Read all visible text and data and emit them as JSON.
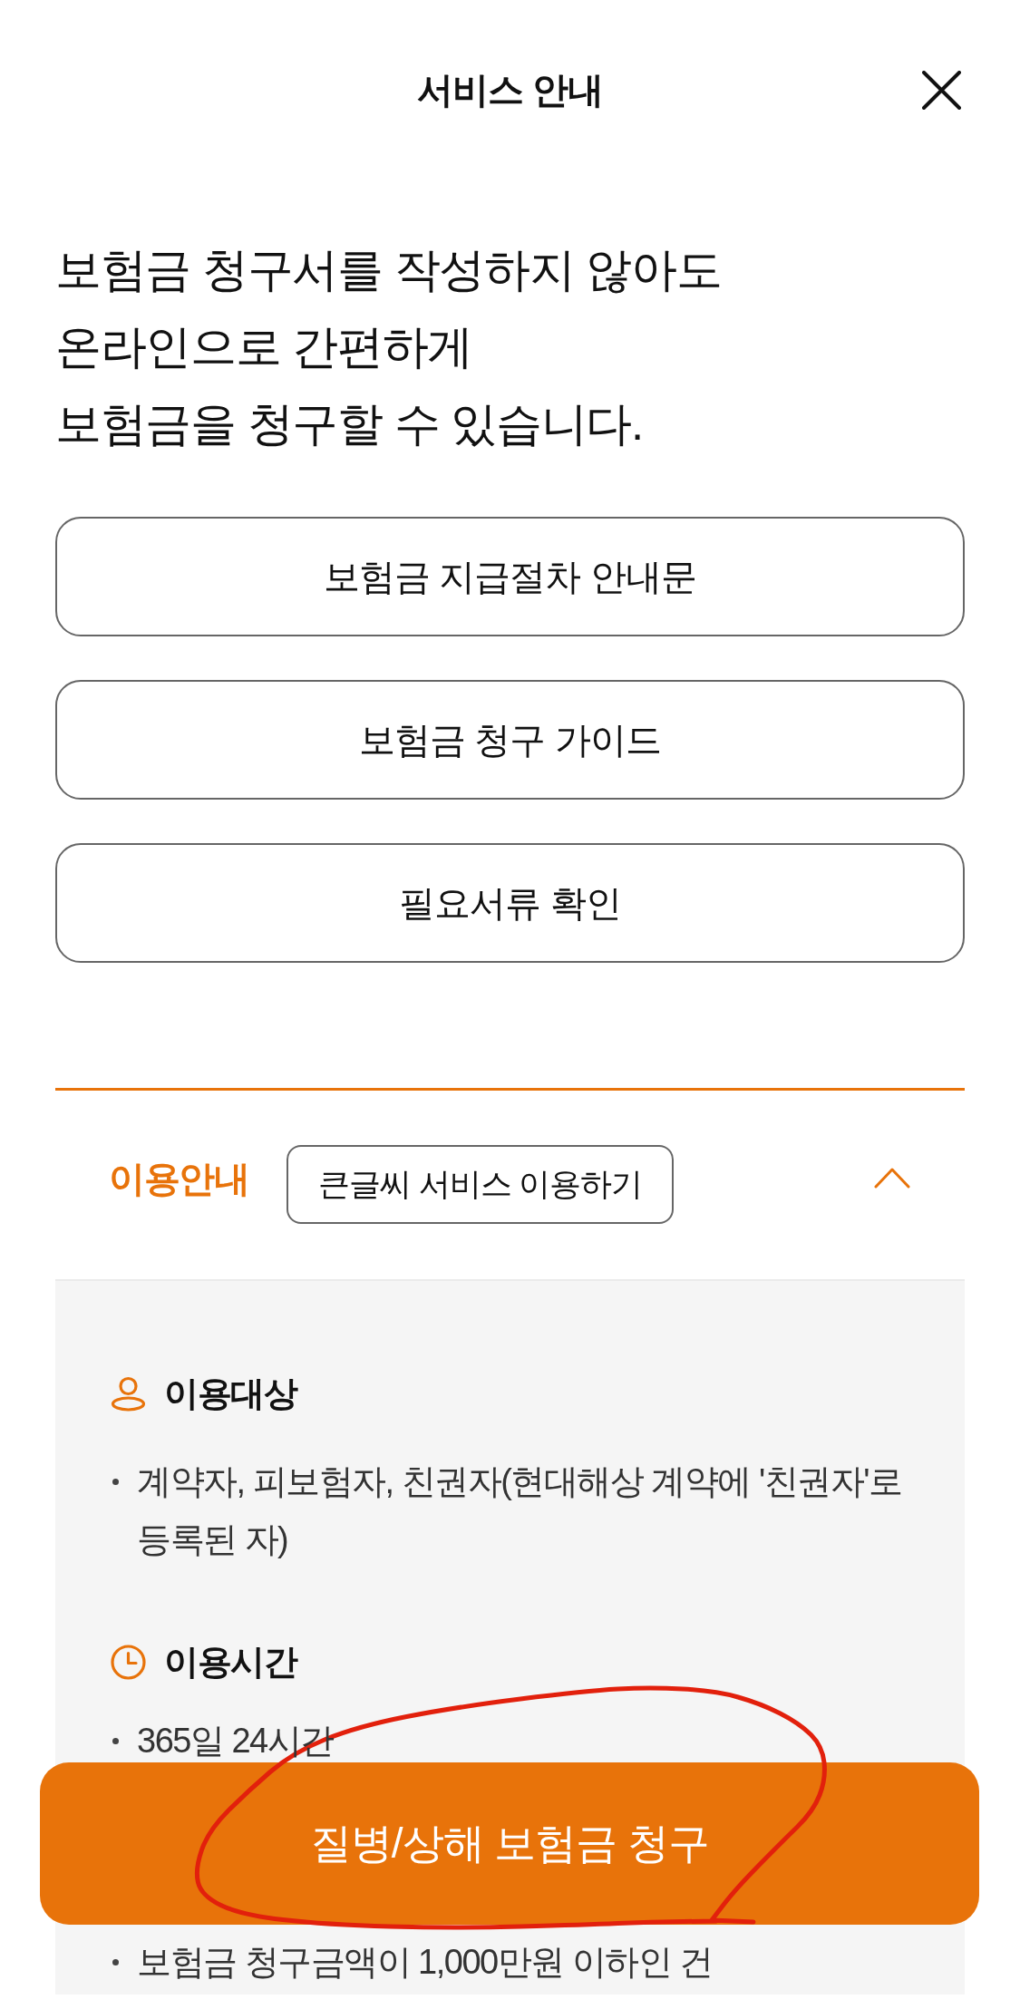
{
  "header": {
    "title": "서비스 안내"
  },
  "intro": {
    "text": "보험금 청구서를 작성하지 않아도\n온라인으로 간편하게\n보험금을 청구할 수 있습니다."
  },
  "links": [
    {
      "label": "보험금 지급절차 안내문"
    },
    {
      "label": "보험금 청구 가이드"
    },
    {
      "label": "필요서류 확인"
    }
  ],
  "usage": {
    "title": "이용안내",
    "large_text_button": {
      "label": "큰글씨 서비스 이용하기"
    },
    "expanded": true,
    "groups": [
      {
        "kind": "person",
        "heading": "이용대상",
        "bullets": [
          "계약자, 피보험자, 친권자(현대해상 계약에 '친권자'로 등록된 자)"
        ]
      },
      {
        "kind": "clock",
        "heading": "이용시간",
        "bullets": [
          "365일 24시간"
        ]
      },
      {
        "kind": "plain",
        "bullets": [
          "보험금 청구금액이 1,000만원 이하인 건"
        ]
      }
    ]
  },
  "claim_button": {
    "label": "질병/상해 보험금 청구"
  }
}
